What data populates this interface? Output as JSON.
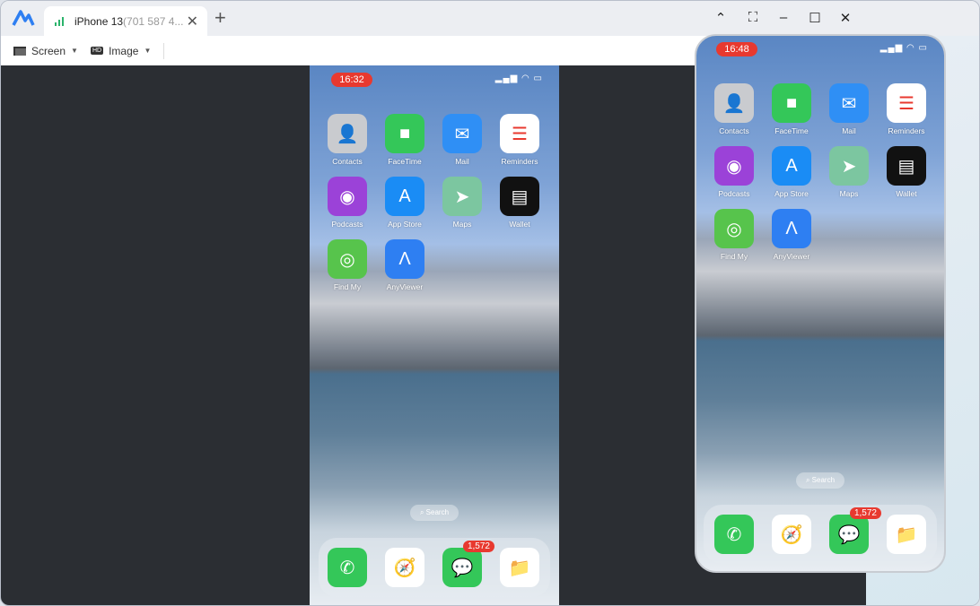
{
  "window": {
    "tab": {
      "name": "iPhone 13",
      "id": "(701 587 4..."
    },
    "controls": [
      "collapse",
      "fullscreen",
      "minimize",
      "maximize",
      "close"
    ]
  },
  "toolbar": {
    "screen_label": "Screen",
    "image_label": "Image",
    "hd_badge": "HD"
  },
  "main_phone": {
    "time": "16:32",
    "search": "Search"
  },
  "side_phone": {
    "time": "16:48",
    "search": "Search"
  },
  "apps": [
    {
      "label": "Contacts",
      "color": "#c9cbcf",
      "glyph": "👤"
    },
    {
      "label": "FaceTime",
      "color": "#34c759",
      "glyph": "■"
    },
    {
      "label": "Mail",
      "color": "#2f8ff5",
      "glyph": "✉"
    },
    {
      "label": "Reminders",
      "color": "#ffffff",
      "glyph": "☰"
    },
    {
      "label": "Podcasts",
      "color": "#9b42d8",
      "glyph": "◉"
    },
    {
      "label": "App Store",
      "color": "#1a8cf5",
      "glyph": "A"
    },
    {
      "label": "Maps",
      "color": "#7cc6a0",
      "glyph": "➤"
    },
    {
      "label": "Wallet",
      "color": "#111111",
      "glyph": "▤"
    },
    {
      "label": "Find My",
      "color": "#57c44c",
      "glyph": "◎"
    },
    {
      "label": "AnyViewer",
      "color": "#2e7ff2",
      "glyph": "Λ"
    }
  ],
  "dock": [
    {
      "name": "phone",
      "color": "#34c759",
      "glyph": "✆"
    },
    {
      "name": "safari",
      "color": "#ffffff",
      "glyph": "🧭"
    },
    {
      "name": "messages",
      "color": "#34c759",
      "glyph": "💬",
      "badge": "1,572"
    },
    {
      "name": "files",
      "color": "#ffffff",
      "glyph": "📁"
    }
  ]
}
